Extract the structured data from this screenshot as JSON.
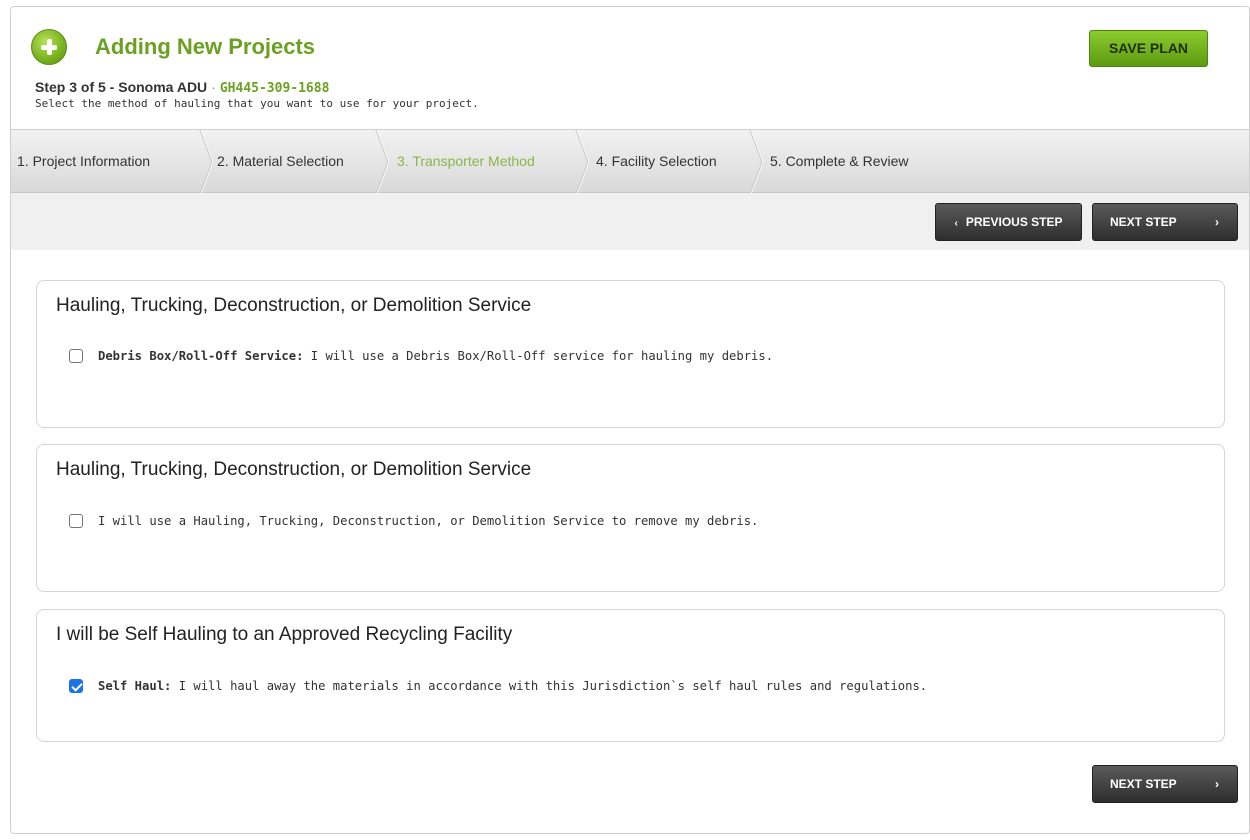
{
  "header": {
    "title": "Adding New Projects",
    "step_label": "Step 3 of 5 - Sonoma ADU",
    "separator": "·",
    "project_code": "GH445-309-1688",
    "instruction": "Select the method of hauling that you want to use for your project.",
    "save_label": "SAVE PLAN"
  },
  "tabs": [
    {
      "label": "1. Project Information",
      "active": false
    },
    {
      "label": "2. Material Selection",
      "active": false
    },
    {
      "label": "3. Transporter Method",
      "active": true
    },
    {
      "label": "4. Facility Selection",
      "active": false
    },
    {
      "label": "5. Complete & Review",
      "active": false
    }
  ],
  "toolbar": {
    "previous_label": "PREVIOUS STEP",
    "previous_icon": "‹",
    "next_label": "NEXT STEP",
    "next_icon": "›"
  },
  "sections": [
    {
      "title": "Hauling, Trucking, Deconstruction, or Demolition Service",
      "option_bold": "Debris Box/Roll-Off Service:",
      "option_text": " I will use a Debris Box/Roll-Off service for hauling my debris.",
      "checked": false
    },
    {
      "title": "Hauling, Trucking, Deconstruction, or Demolition Service",
      "option_bold": "",
      "option_text": "I will use a Hauling, Trucking, Deconstruction, or Demolition Service to remove my debris.",
      "checked": false
    },
    {
      "title": "I will be Self Hauling to an Approved Recycling Facility",
      "option_bold": "Self Haul:",
      "option_text": " I will haul away the materials in accordance with this Jurisdiction`s self haul rules and regulations.",
      "checked": true
    }
  ],
  "footer": {
    "next_label": "NEXT STEP",
    "next_icon": "›"
  },
  "colors": {
    "brand_green": "#6aa121",
    "active_tab": "#8ab64a",
    "checkbox_checked": "#1a73e8"
  }
}
